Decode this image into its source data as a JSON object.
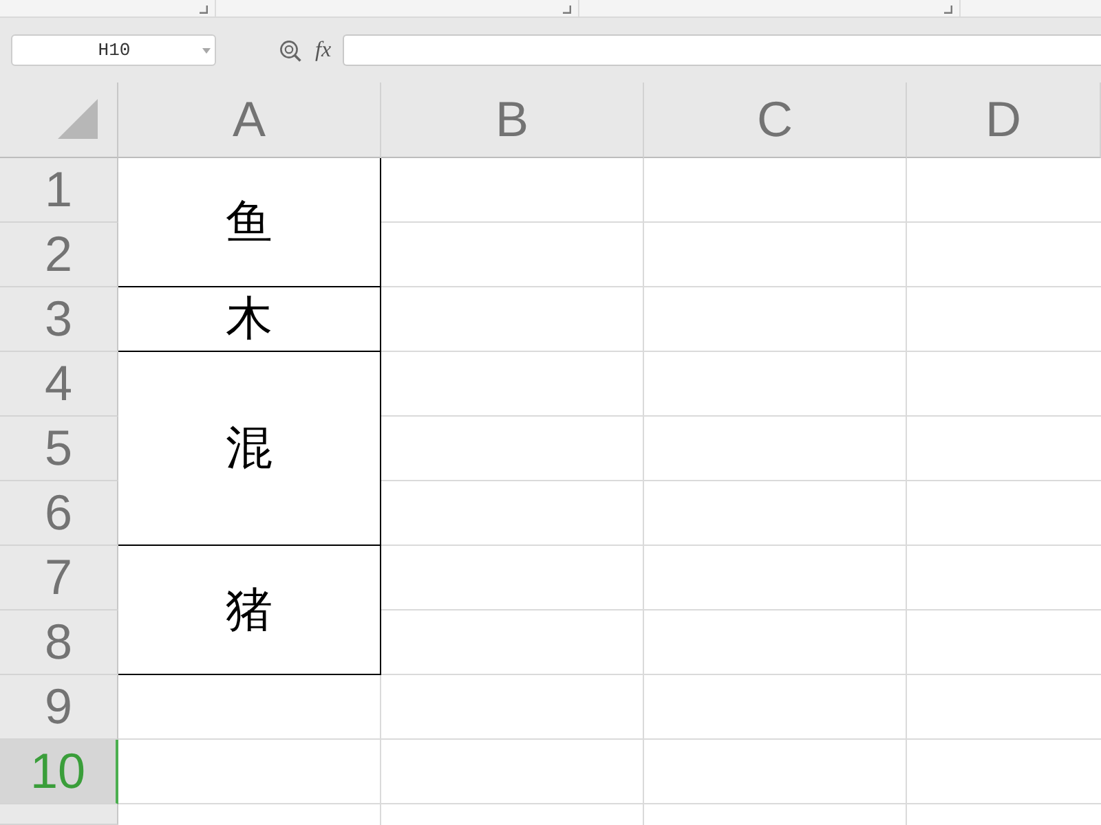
{
  "name_box": {
    "value": "H10"
  },
  "formula_bar": {
    "function_label": "fx"
  },
  "sheet": {
    "columns": [
      {
        "label": "A",
        "selected": false
      },
      {
        "label": "B",
        "selected": false
      },
      {
        "label": "C",
        "selected": false
      },
      {
        "label": "D",
        "selected": false
      }
    ],
    "rows": [
      {
        "label": "1",
        "selected": false,
        "cells": [
          {
            "kind": "text",
            "text": "鱼"
          }
        ]
      },
      {
        "label": "2",
        "selected": false,
        "cells": [
          {
            "kind": "merged"
          }
        ]
      },
      {
        "label": "3",
        "selected": false,
        "cells": [
          {
            "kind": "text",
            "text": "木"
          }
        ]
      },
      {
        "label": "4",
        "selected": false,
        "cells": [
          {
            "kind": "text",
            "text": "混"
          }
        ]
      },
      {
        "label": "5",
        "selected": false,
        "cells": [
          {
            "kind": "merged"
          }
        ]
      },
      {
        "label": "6",
        "selected": false,
        "cells": [
          {
            "kind": "merged"
          }
        ]
      },
      {
        "label": "7",
        "selected": false,
        "cells": [
          {
            "kind": "text",
            "text": "猪"
          }
        ]
      },
      {
        "label": "8",
        "selected": false,
        "cells": [
          {
            "kind": "merged"
          }
        ]
      },
      {
        "label": "9",
        "selected": false
      },
      {
        "label": "10",
        "selected": true
      }
    ]
  }
}
